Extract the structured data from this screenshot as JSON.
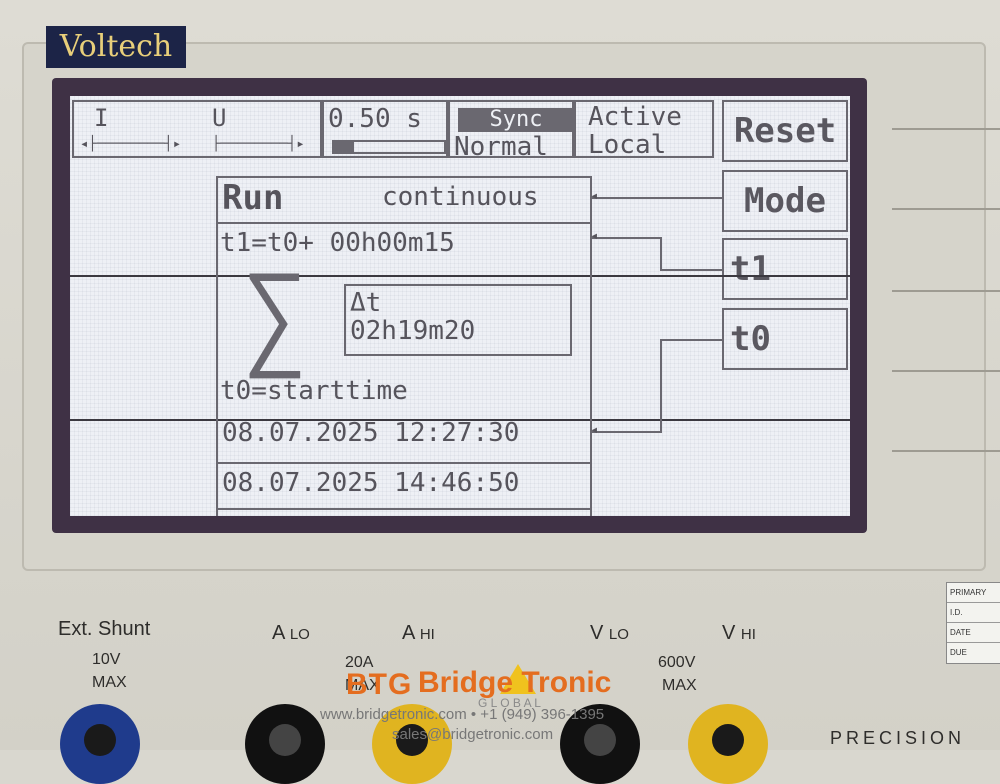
{
  "brand": {
    "logo_text": "Voltech"
  },
  "status_bar": {
    "current_label": "I",
    "voltage_label": "U",
    "interval": "0.50 s",
    "sync": "Sync",
    "mode_line": "Normal",
    "active": "Active",
    "local": "Local"
  },
  "buttons": {
    "reset": "Reset",
    "mode": "Mode",
    "t1": "t1",
    "t0": "t0"
  },
  "run": {
    "title": "Run",
    "mode_value": "continuous",
    "t1_line": "t1=t0+ 00h00m15",
    "sigma": "∑",
    "delta_label": "Δt",
    "delta_value": "02h19m20",
    "t0_line": "t0=starttime",
    "start_datetime": "08.07.2025 12:27:30",
    "current_datetime": "08.07.2025 14:46:50"
  },
  "front_panel": {
    "ext_shunt": "Ext. Shunt",
    "ext_max": "10V",
    "ext_max2": "MAX",
    "a_lo": "A",
    "a_lo_sub": "LO",
    "a_hi": "A",
    "a_hi_sub": "HI",
    "amp_max": "20A",
    "amp_max2": "MAX",
    "v_lo": "V",
    "v_lo_sub": "LO",
    "v_hi": "V",
    "v_hi_sub": "HI",
    "volt_max": "600V",
    "volt_max2": "MAX",
    "precision": "PRECISION"
  },
  "watermark": {
    "name": "Bridge Tronic",
    "sub": "G L O B A L",
    "contact": "www.bridgetronic.com • +1 (949) 396-1395",
    "email": "sales@bridgetronic.com",
    "logo_mark": "BTG"
  },
  "sticker": {
    "title": "PRIMARY",
    "row1": "I.D.",
    "row2": "DATE",
    "row3": "DUE"
  }
}
